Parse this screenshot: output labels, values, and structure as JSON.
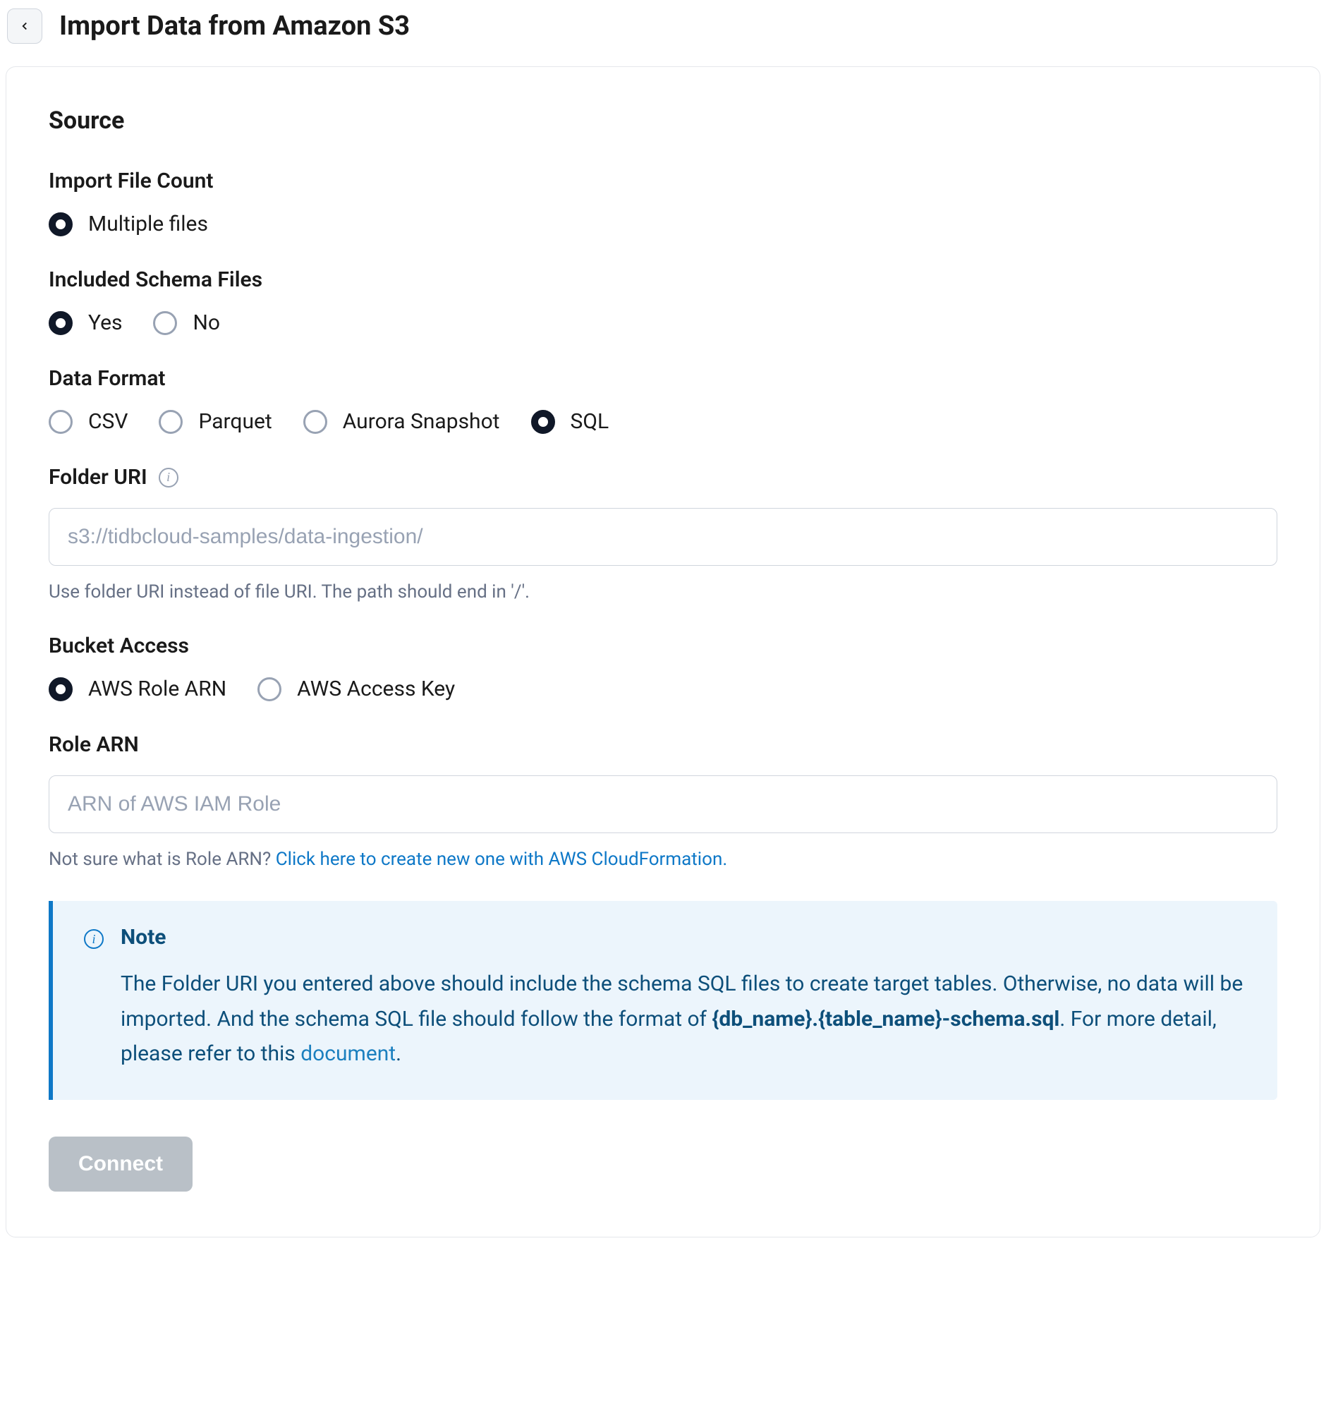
{
  "header": {
    "title": "Import Data from Amazon S3"
  },
  "source": {
    "heading": "Source",
    "import_file_count": {
      "label": "Import File Count",
      "options": {
        "multiple_files": "Multiple files"
      },
      "selected": "multiple_files"
    },
    "included_schema_files": {
      "label": "Included Schema Files",
      "options": {
        "yes": "Yes",
        "no": "No"
      },
      "selected": "yes"
    },
    "data_format": {
      "label": "Data Format",
      "options": {
        "csv": "CSV",
        "parquet": "Parquet",
        "aurora": "Aurora Snapshot",
        "sql": "SQL"
      },
      "selected": "sql"
    },
    "folder_uri": {
      "label": "Folder URI",
      "value": "",
      "placeholder": "s3://tidbcloud-samples/data-ingestion/",
      "help": "Use folder URI instead of file URI. The path should end in '/'."
    },
    "bucket_access": {
      "label": "Bucket Access",
      "options": {
        "role_arn": "AWS Role ARN",
        "access_key": "AWS Access Key"
      },
      "selected": "role_arn"
    },
    "role_arn": {
      "label": "Role ARN",
      "value": "",
      "placeholder": "ARN of AWS IAM Role",
      "help_prefix": "Not sure what is Role ARN? ",
      "help_link": "Click here to create new one with AWS CloudFormation."
    },
    "note": {
      "title": "Note",
      "body_1": "The Folder URI you entered above should include the schema SQL files to create target tables. Otherwise, no data will be imported. And the schema SQL file should follow the format of ",
      "body_bold": "{db_name}.{table_name}-schema.sql",
      "body_2": ". For more detail, please refer to this ",
      "body_link": "document",
      "body_3": "."
    },
    "connect_label": "Connect"
  }
}
